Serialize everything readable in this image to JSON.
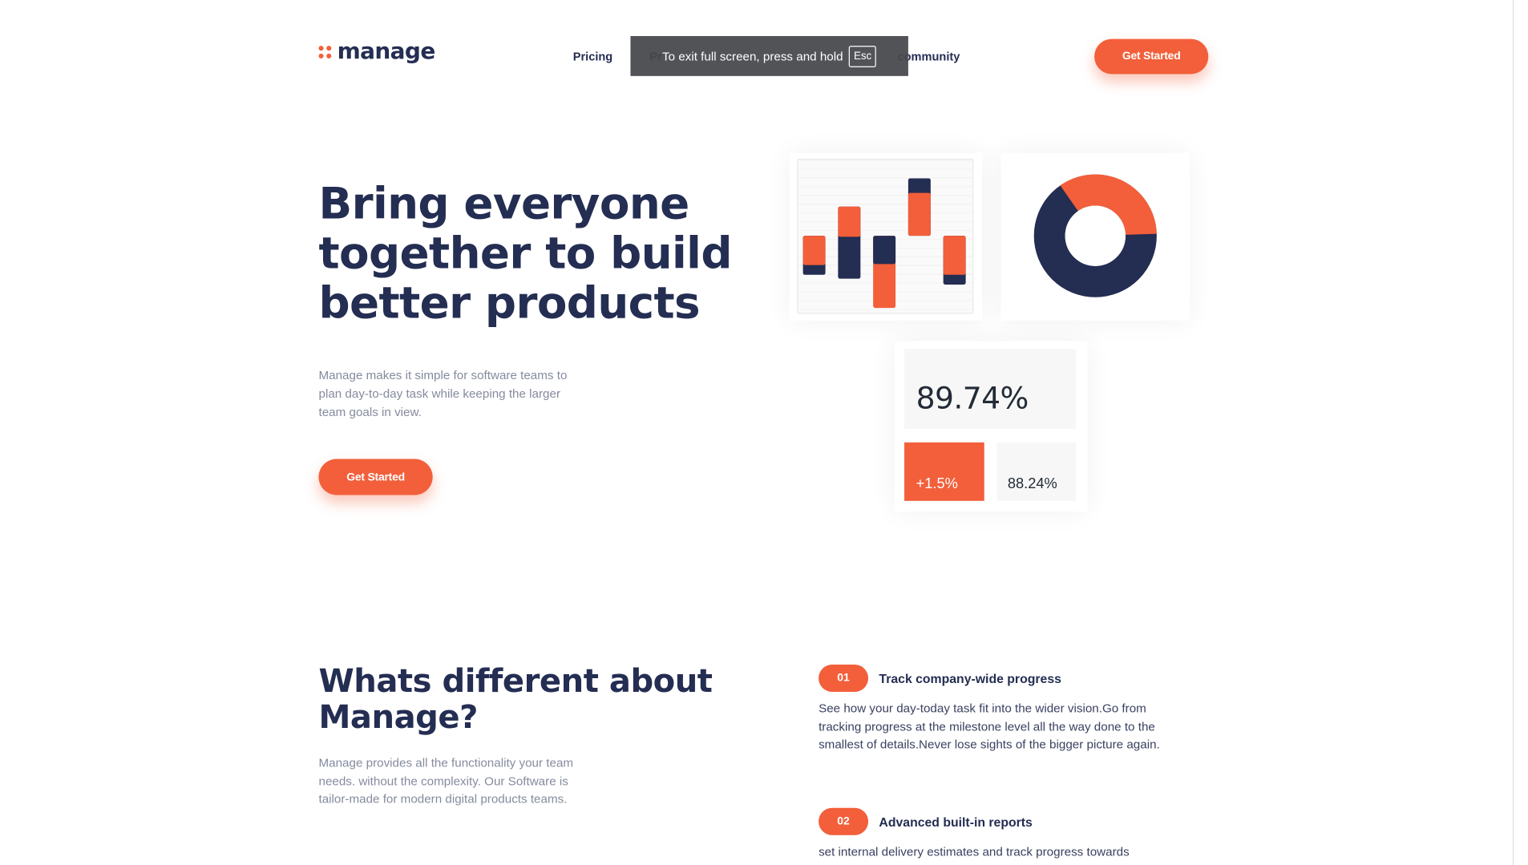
{
  "header": {
    "logo_text": "manage",
    "nav": {
      "pricing": "Pricing",
      "product_partial": "Pr",
      "community": "community"
    },
    "cta_label": "Get Started"
  },
  "fullscreen_notice": {
    "message": "To exit full screen, press and hold",
    "key": "Esc"
  },
  "hero": {
    "title": "Bring everyone together to build better products",
    "description": "Manage makes it simple for software teams to plan day-to-day task while keeping the larger team goals in view.",
    "cta_label": "Get Started"
  },
  "illustration": {
    "main_stat": "89.74%",
    "increase": "+1.5%",
    "secondary_stat": "88.24%",
    "colors": {
      "accent": "#f25f3a",
      "navy": "#242d52"
    }
  },
  "features": {
    "title": "Whats different about Manage?",
    "description": "Manage provides all the functionality your team needs. without the complexity. Our Software is tailor-made for modern digital products teams.",
    "items": [
      {
        "number": "01",
        "title": "Track company-wide progress",
        "text": "See how your day-today task fit into the wider vision.Go from tracking progress at the milestone level all the way done to the smallest of details.Never lose sights of the bigger picture again."
      },
      {
        "number": "02",
        "title": "Advanced built-in reports",
        "text": "set internal delivery estimates and track progress towards"
      }
    ]
  },
  "colors": {
    "accent": "#f25f3a",
    "heading": "#242d52",
    "muted_text": "#858b9e"
  }
}
